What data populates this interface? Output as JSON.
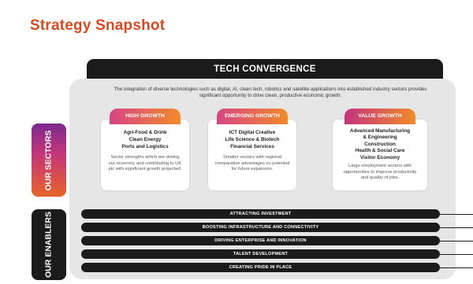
{
  "title": "Strategy Snapshot",
  "tech_convergence": {
    "heading": "TECH CONVERGENCE",
    "description": "The integration of diverse technologies such as digital, AI, clean tech, robotics and satellite applications into established industry sectors provides significant opportunity to drive clean, productive economic growth."
  },
  "side_labels": {
    "sectors": "OUR SECTORS",
    "enablers": "OUR ENABLERS"
  },
  "sectors": [
    {
      "label": "HIGH GROWTH",
      "items": [
        "Agri-Food & Drink",
        "Clean Energy",
        "Ports and Logistics"
      ],
      "description": "Sector strengths which are driving our economy and contributing to UK plc with significant growth projected."
    },
    {
      "label": "EMERGING GROWTH",
      "items": [
        "ICT Digital Creative",
        "Life Science & Biotech",
        "Financial Services"
      ],
      "description": "Smaller sectors with regional comparative advantages so potential for future expansion."
    },
    {
      "label": "VALUE GROWTH",
      "items": [
        "Advanced Manufacturing",
        "& Engineering",
        "Construction",
        "Health & Social Care",
        "Visitor Economy"
      ],
      "description": "Large employment sectors with opportunities to improve productivity and quality of jobs."
    }
  ],
  "enablers": [
    "ATTRACTING INVESTMENT",
    "BOOSTING INFRASTRUCTURE AND CONNECTIVITY",
    "DRIVING ENTERPRISE AND INNOVATION",
    "TALENT DEVELOPMENT",
    "CREATING PRIDE IN PLACE"
  ],
  "colors": {
    "title": "#d84a1f",
    "dark": "#1b1b1b",
    "panel": "#e6e6e6",
    "gradient_start": "#7b2a8f",
    "gradient_end": "#e8632a"
  }
}
